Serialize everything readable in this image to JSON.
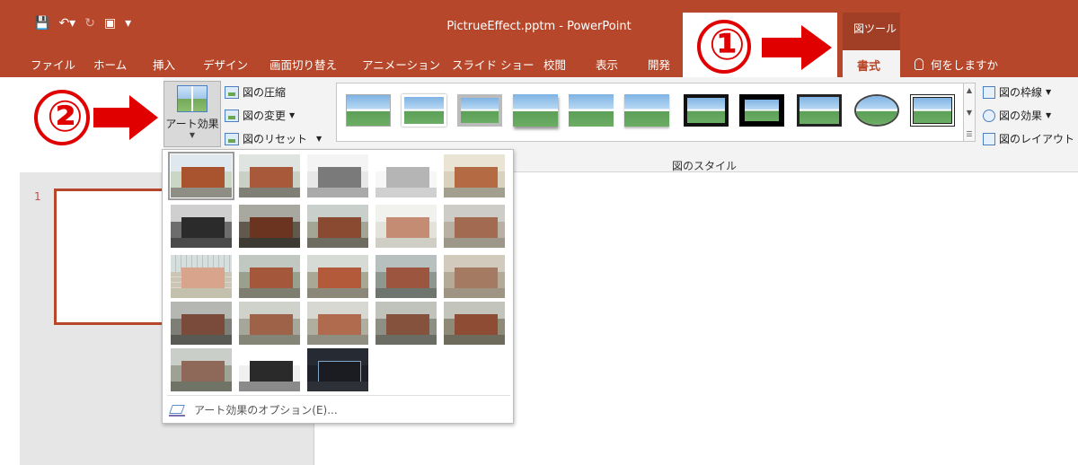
{
  "app": {
    "title": "PictrueEffect.pptm  -  PowerPoint",
    "contextual_header": "図ツール",
    "contextual_tab": "書式",
    "tell_me": "何をしますか"
  },
  "quick_access": {
    "icons": [
      "save-icon",
      "undo-icon",
      "redo-icon",
      "presentation-icon",
      "customize-icon"
    ]
  },
  "tabs": [
    {
      "label": "ファイル"
    },
    {
      "label": "ホーム"
    },
    {
      "label": "挿入"
    },
    {
      "label": "デザイン"
    },
    {
      "label": "画面切り替え"
    },
    {
      "label": "アニメーション"
    },
    {
      "label": "スライド ショー"
    },
    {
      "label": "校閲"
    },
    {
      "label": "表示"
    },
    {
      "label": "開発"
    }
  ],
  "ribbon": {
    "art_effects_label": "アート効果",
    "compress_label": "図の圧縮",
    "change_label": "図の変更",
    "reset_label": "図のリセット",
    "styles_group_label": "図のスタイル",
    "border_label": "図の枠線",
    "effects_label": "図の効果",
    "layout_label": "図のレイアウト"
  },
  "art_effects_menu": {
    "option_label": "アート効果のオプション(E)..."
  },
  "slides": {
    "number": "1"
  },
  "annotations": {
    "step1": "①",
    "step2": "②",
    "color": "#e00000"
  },
  "colors": {
    "accent": "#b7472a",
    "ribbon_bg": "#f3f3f3"
  }
}
